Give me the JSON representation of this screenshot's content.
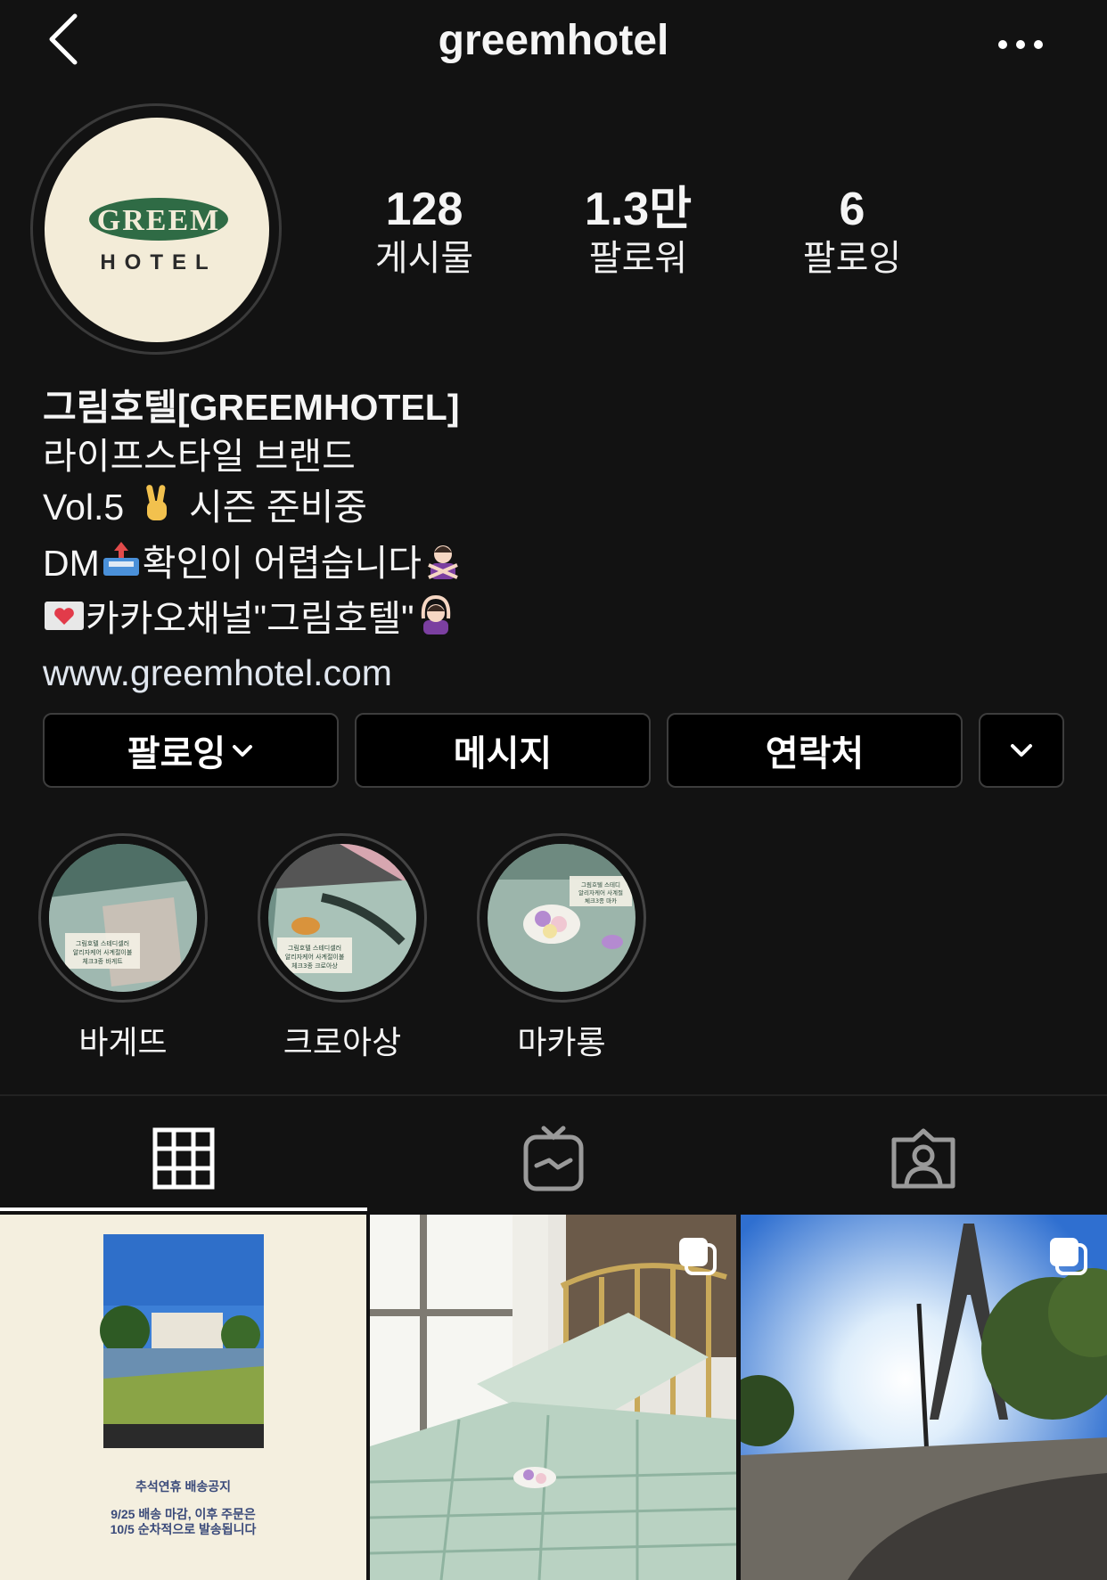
{
  "header": {
    "username": "greemhotel",
    "back_icon": "chevron-left-icon",
    "more_icon": "more-horizontal-icon"
  },
  "avatar": {
    "logo_top": "GREEM",
    "logo_bottom": "HOTEL"
  },
  "stats": [
    {
      "value": "128",
      "label": "게시물"
    },
    {
      "value": "1.3만",
      "label": "팔로워"
    },
    {
      "value": "6",
      "label": "팔로잉"
    }
  ],
  "bio": {
    "name": "그림호텔[GREEMHOTEL]",
    "line1": "라이프스타일 브랜드",
    "line2_a": "Vol.5",
    "line2_b": "시즌 준비중",
    "line3_a": "DM",
    "line3_b": "확인이 어렵습니다",
    "line4": "카카오채널\"그림호텔\"",
    "link": "www.greemhotel.com"
  },
  "actions": {
    "follow": "팔로잉",
    "message": "메시지",
    "contact": "연락처"
  },
  "highlights": [
    {
      "label": "바게뜨",
      "caption": "그림호텔 스테디셀러 알리자케어 사계절이불 체크3종 바게트"
    },
    {
      "label": "크로아상",
      "caption": "그림호텔 스테디셀러 알리자케어 사계절이불 체크3종 크로아상"
    },
    {
      "label": "마카롱",
      "caption": "그림호텔 스테디셀러 알리자케어 사계절이불 체크3종 마카롱"
    }
  ],
  "tabs": [
    {
      "name": "grid",
      "icon": "grid-icon"
    },
    {
      "name": "igtv",
      "icon": "igtv-icon"
    },
    {
      "name": "tagged",
      "icon": "tagged-user-icon"
    }
  ],
  "posts": [
    {
      "title": "추석연휴 배송공지",
      "notice_line1": "9/25 배송 마감, 이후 주문은",
      "notice_line2": "10/5 순차적으로 발송됩니다"
    },
    {
      "multi": true
    },
    {
      "multi": true
    }
  ],
  "colors": {
    "background": "#121212",
    "button_bg": "#000000",
    "avatar_bg": "#f3ecd8",
    "logo_green": "#2f6b45"
  }
}
